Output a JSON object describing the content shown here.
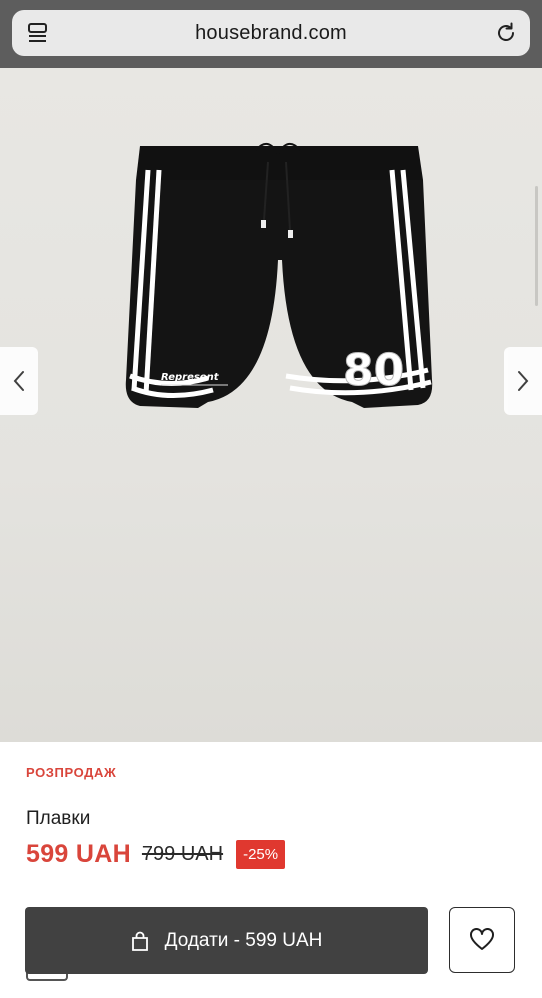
{
  "browser": {
    "url": "housebrand.com",
    "tabs_icon": "tabs-icon",
    "reload_icon": "reload-icon"
  },
  "gallery": {
    "prev_icon": "chevron-left-icon",
    "next_icon": "chevron-right-icon",
    "print_logo": "Represent",
    "print_number": "80"
  },
  "product": {
    "badge": "РОЗПРОДАЖ",
    "name": "Плавки",
    "price": "599 UAH",
    "old_price": "799 UAH",
    "discount": "-25%",
    "add_to_cart": "Додати - 599 UAH",
    "cart_icon": "shopping-bag-icon",
    "wishlist_icon": "heart-icon"
  },
  "colors": {
    "sale_red": "#d9453b",
    "badge_red": "#e0382f",
    "button_dark": "#414141"
  }
}
